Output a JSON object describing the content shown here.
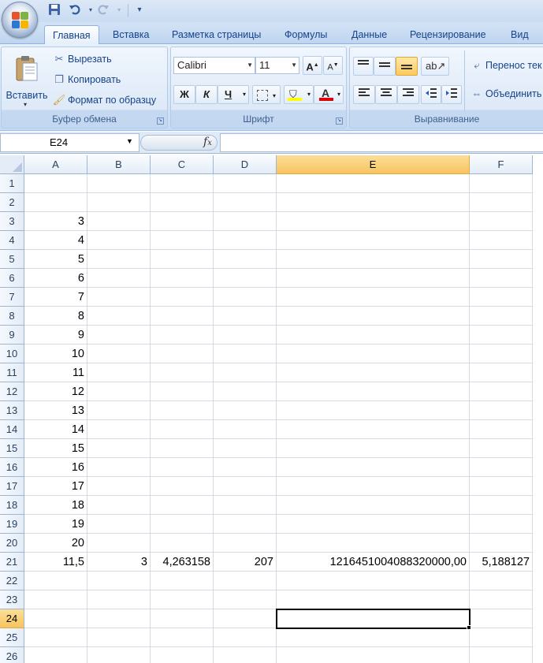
{
  "quick_access": {
    "icons": [
      "save-icon",
      "undo-icon",
      "redo-icon",
      "customize-icon"
    ]
  },
  "tabs": [
    {
      "label": "Главная",
      "active": true
    },
    {
      "label": "Вставка"
    },
    {
      "label": "Разметка страницы"
    },
    {
      "label": "Формулы"
    },
    {
      "label": "Данные"
    },
    {
      "label": "Рецензирование"
    },
    {
      "label": "Вид"
    }
  ],
  "ribbon": {
    "clipboard": {
      "paste_label": "Вставить",
      "cut_label": "Вырезать",
      "copy_label": "Копировать",
      "format_painter_label": "Формат по образцу",
      "group_label": "Буфер обмена"
    },
    "font": {
      "font_name": "Calibri",
      "font_size": "11",
      "bold_label": "Ж",
      "italic_label": "К",
      "underline_label": "Ч",
      "font_color_label": "А",
      "group_label": "Шрифт"
    },
    "alignment": {
      "wrap_label": "Перенос тек",
      "merge_label": "Объединить",
      "group_label": "Выравнивание"
    }
  },
  "formula_bar": {
    "name_box": "E24",
    "fx_label": "fx",
    "formula": ""
  },
  "sheet": {
    "columns": [
      "A",
      "B",
      "C",
      "D",
      "E",
      "F"
    ],
    "selected_column": "E",
    "rows": [
      "1",
      "2",
      "3",
      "4",
      "5",
      "6",
      "7",
      "8",
      "9",
      "10",
      "11",
      "12",
      "13",
      "14",
      "15",
      "16",
      "17",
      "18",
      "19",
      "20",
      "21",
      "22",
      "23",
      "24",
      "25",
      "26"
    ],
    "selected_row": "24",
    "column_a_values": [
      "",
      "",
      "3",
      "4",
      "5",
      "6",
      "7",
      "8",
      "9",
      "10",
      "11",
      "12",
      "13",
      "14",
      "15",
      "16",
      "17",
      "18",
      "19",
      "20"
    ],
    "row21": {
      "A": "11,5",
      "B": "3",
      "C": "4,263158",
      "D": "207",
      "E": "1216451004088320000,00",
      "F": "5,188127"
    }
  },
  "colors": {
    "ribbon_text": "#15428b",
    "selection_header": "#f7c45e",
    "grid_line": "#d4dbe5"
  }
}
